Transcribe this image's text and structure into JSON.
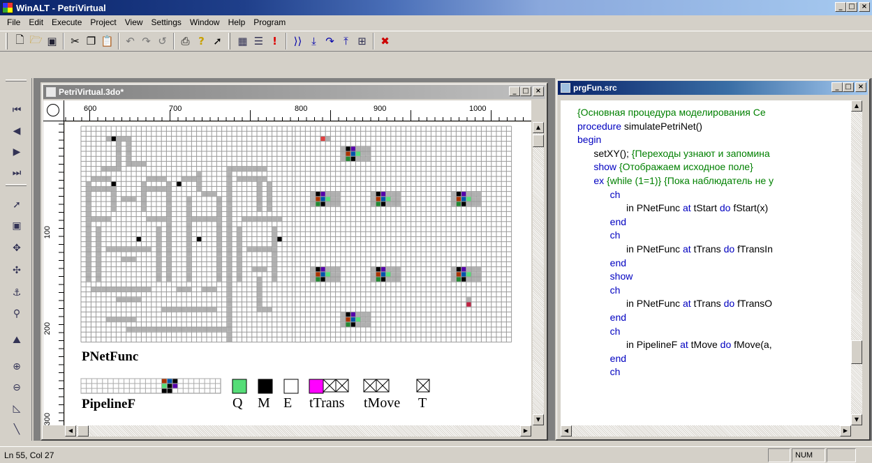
{
  "window": {
    "title": "WinALT - PetriVirtual"
  },
  "menu": [
    "File",
    "Edit",
    "Execute",
    "Project",
    "View",
    "Settings",
    "Window",
    "Help",
    "Program"
  ],
  "toolbar": {
    "icons": [
      "new-icon",
      "open-icon",
      "save-icon",
      "cut-icon",
      "copy-icon",
      "paste-icon",
      "undo-icon",
      "redo-icon",
      "refresh-icon",
      "print-icon",
      "help-icon",
      "context-help-icon",
      "grid-icon",
      "list-icon",
      "run-icon",
      "step-icon",
      "step-into-icon",
      "step-over-icon",
      "step-out-icon",
      "watch-icon",
      "stop-icon"
    ]
  },
  "doc": {
    "title": "PetriVirtual.3do*",
    "ruler_top": [
      "600",
      "700",
      "800",
      "900",
      "1000"
    ],
    "ruler_left": [
      "100",
      "200",
      "300"
    ],
    "objects": {
      "pnetfunc": "PNetFunc",
      "pipeline": "PipelineF",
      "legend": [
        "Q",
        "M",
        "E",
        "tTrans",
        "tMove",
        "T"
      ]
    }
  },
  "src": {
    "title": "prgFun.src",
    "lines": [
      [
        {
          "t": "{Основная процедура моделирования Се",
          "c": "#008000"
        }
      ],
      [
        {
          "t": "procedure",
          "c": "#0000c0"
        },
        {
          "t": " simulatePetriNet()",
          "c": "#000000"
        }
      ],
      [
        {
          "t": "begin",
          "c": "#0000c0"
        }
      ],
      [
        {
          "t": "      setXY(); ",
          "c": "#000000"
        },
        {
          "t": "{Переходы узнают и запомина",
          "c": "#008000"
        }
      ],
      [
        {
          "t": "      show ",
          "c": "#0000c0"
        },
        {
          "t": "{Отображаем исходное поле}",
          "c": "#008000"
        }
      ],
      [
        {
          "t": "      ex ",
          "c": "#0000c0"
        },
        {
          "t": "{while (1=1)} {Пока наблюдатель не у",
          "c": "#008000"
        }
      ],
      [
        {
          "t": "            ch",
          "c": "#0000c0"
        }
      ],
      [
        {
          "t": "                  in PNetFunc ",
          "c": "#000000"
        },
        {
          "t": "at",
          "c": "#0000c0"
        },
        {
          "t": " tStart ",
          "c": "#000000"
        },
        {
          "t": "do",
          "c": "#0000c0"
        },
        {
          "t": " fStart(x)",
          "c": "#000000"
        }
      ],
      [
        {
          "t": "            end",
          "c": "#0000c0"
        }
      ],
      [
        {
          "t": "            ch",
          "c": "#0000c0"
        }
      ],
      [
        {
          "t": "                  in PNetFunc ",
          "c": "#000000"
        },
        {
          "t": "at",
          "c": "#0000c0"
        },
        {
          "t": " tTrans ",
          "c": "#000000"
        },
        {
          "t": "do",
          "c": "#0000c0"
        },
        {
          "t": " fTransIn",
          "c": "#000000"
        }
      ],
      [
        {
          "t": "            end",
          "c": "#0000c0"
        }
      ],
      [
        {
          "t": "            show",
          "c": "#0000c0"
        }
      ],
      [
        {
          "t": "            ch",
          "c": "#0000c0"
        }
      ],
      [
        {
          "t": "                  in PNetFunc ",
          "c": "#000000"
        },
        {
          "t": "at",
          "c": "#0000c0"
        },
        {
          "t": " tTrans ",
          "c": "#000000"
        },
        {
          "t": "do",
          "c": "#0000c0"
        },
        {
          "t": " fTransO",
          "c": "#000000"
        }
      ],
      [
        {
          "t": "            end",
          "c": "#0000c0"
        }
      ],
      [
        {
          "t": "            ch",
          "c": "#0000c0"
        }
      ],
      [
        {
          "t": "                  in PipelineF ",
          "c": "#000000"
        },
        {
          "t": "at",
          "c": "#0000c0"
        },
        {
          "t": " tMove ",
          "c": "#000000"
        },
        {
          "t": "do",
          "c": "#0000c0"
        },
        {
          "t": " fMove(a,",
          "c": "#000000"
        }
      ],
      [
        {
          "t": "            end",
          "c": "#0000c0"
        }
      ],
      [
        {
          "t": "            ch",
          "c": "#0000c0"
        }
      ]
    ]
  },
  "status": {
    "position": "Ln 55, Col 27",
    "num": "NUM"
  },
  "colors": {
    "legend_q": "#55dd77",
    "legend_m": "#000000",
    "legend_ttrans": "#ff00ff",
    "active_title": "#0a246a"
  }
}
